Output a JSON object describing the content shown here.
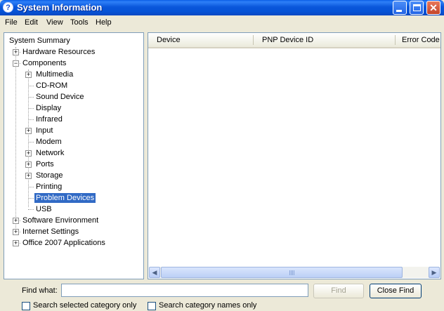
{
  "window": {
    "title": "System Information",
    "app_icon_glyph": "?",
    "close_glyph": "✕"
  },
  "menu": [
    "File",
    "Edit",
    "View",
    "Tools",
    "Help"
  ],
  "tree": {
    "items": [
      {
        "label": "System Summary",
        "expander": ""
      },
      {
        "label": "Hardware Resources",
        "expander": "+"
      },
      {
        "label": "Components",
        "expander": "−"
      },
      {
        "label": "Multimedia",
        "expander": "+"
      },
      {
        "label": "CD-ROM",
        "expander": ""
      },
      {
        "label": "Sound Device",
        "expander": ""
      },
      {
        "label": "Display",
        "expander": ""
      },
      {
        "label": "Infrared",
        "expander": ""
      },
      {
        "label": "Input",
        "expander": "+"
      },
      {
        "label": "Modem",
        "expander": ""
      },
      {
        "label": "Network",
        "expander": "+"
      },
      {
        "label": "Ports",
        "expander": "+"
      },
      {
        "label": "Storage",
        "expander": "+"
      },
      {
        "label": "Printing",
        "expander": ""
      },
      {
        "label": "Problem Devices",
        "expander": "",
        "selected": true
      },
      {
        "label": "USB",
        "expander": ""
      },
      {
        "label": "Software Environment",
        "expander": "+"
      },
      {
        "label": "Internet Settings",
        "expander": "+"
      },
      {
        "label": "Office 2007 Applications",
        "expander": "+"
      }
    ]
  },
  "table": {
    "columns": [
      "Device",
      "PNP Device ID",
      "Error Code"
    ]
  },
  "find": {
    "label": "Find what:",
    "value": "",
    "find_button": "Find",
    "close_button": "Close Find",
    "option_selected_category": "Search selected category only",
    "option_category_names": "Search category names only"
  },
  "colors": {
    "title_bar": "#0a56db",
    "selection": "#316ac5",
    "window_bg": "#ece9d8"
  }
}
